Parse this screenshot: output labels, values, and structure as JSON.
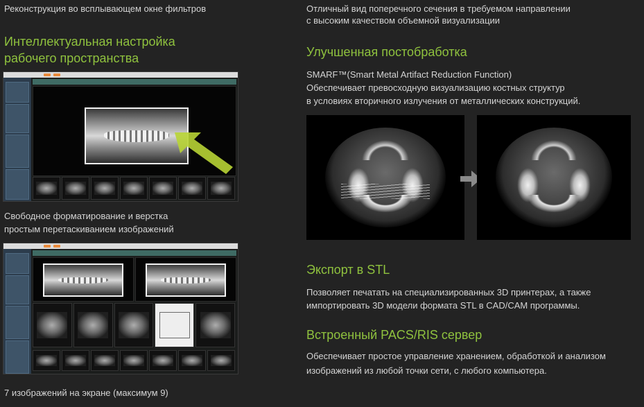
{
  "left": {
    "top_caption": "Реконструкция во всплывающем окне фильтров",
    "section1": {
      "heading_line1": "Интеллектуальная настройка",
      "heading_line2": "рабочего пространства"
    },
    "caption2_line1": "Свободное форматирование и верстка",
    "caption2_line2": "простым перетаскиванием изображений",
    "bottom_caption": "7 изображений на экране (максимум 9)"
  },
  "right": {
    "intro_line1": "Отличный вид поперечного сечения в требуемом направлении",
    "intro_line2": "с высоким качеством объемной визуализации",
    "postprocessing": {
      "heading": "Улучшенная постобработка",
      "line1": "SMARF™(Smart Metal Artifact Reduction Function)",
      "line2": "Обеспечивает превосходную визуализацию костных структур",
      "line3": "в условиях вторичного излучения от металлических конструкций."
    },
    "stl": {
      "heading": "Экспорт в STL",
      "line1": "Позволяет печатать на специализированных 3D принтерах, а также",
      "line2": "импортировать 3D модели формата STL в CAD/CAM программы."
    },
    "pacs": {
      "heading": "Встроенный PACS/RIS сервер",
      "line1": "Обеспечивает простое управление хранением, обработкой и анализом",
      "line2": "изображений из любой точки сети, с любого компьютера."
    }
  },
  "colors": {
    "background": "#232323",
    "heading_green": "#8fc23e",
    "text": "#d4d4d4"
  }
}
